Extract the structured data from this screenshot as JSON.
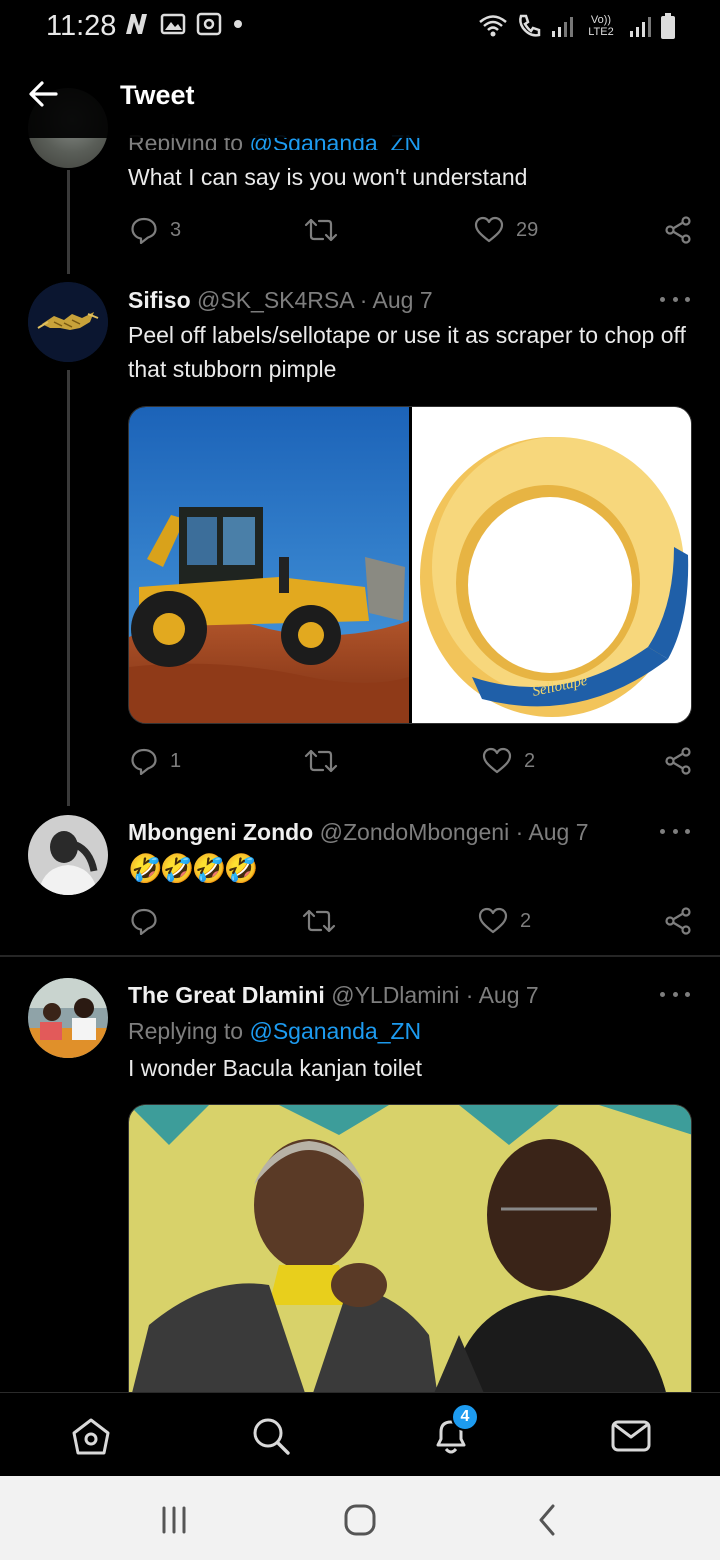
{
  "status_bar": {
    "time": "11:28",
    "network_label": "Vo)) LTE2"
  },
  "header": {
    "title": "Tweet",
    "back_icon": "arrow-left-icon"
  },
  "tweets": [
    {
      "replying_prefix": "Replying to",
      "replying_handle": "@Sgananda_ZN",
      "text": "What I can say is you won't understand",
      "reply_count": "3",
      "retweet_count": "",
      "like_count": "29"
    },
    {
      "name": "Sifiso",
      "handle": "@SK_SK4RSA",
      "date": "Aug 7",
      "text": "Peel off labels/sellotape or use it as scraper to chop off that stubborn pimple",
      "reply_count": "1",
      "retweet_count": "",
      "like_count": "2",
      "tape_label": "Sellotape"
    },
    {
      "name": "Mbongeni Zondo",
      "handle": "@ZondoMbongeni",
      "date": "Aug 7",
      "text": "🤣🤣🤣🤣",
      "reply_count": "",
      "retweet_count": "",
      "like_count": "2"
    },
    {
      "name": "The Great Dlamini",
      "handle": "@YLDlamini",
      "date": "Aug 7",
      "replying_prefix": "Replying to",
      "replying_handle": "@Sgananda_ZN",
      "text": "I wonder Bacula kanjan toilet"
    }
  ],
  "separator": "·",
  "bottom_nav": {
    "items": [
      "home-icon",
      "search-icon",
      "notifications-icon",
      "messages-icon"
    ],
    "notification_badge": "4"
  },
  "colors": {
    "background": "#000000",
    "accent": "#1d9bf0",
    "muted": "#7e7e7e"
  }
}
